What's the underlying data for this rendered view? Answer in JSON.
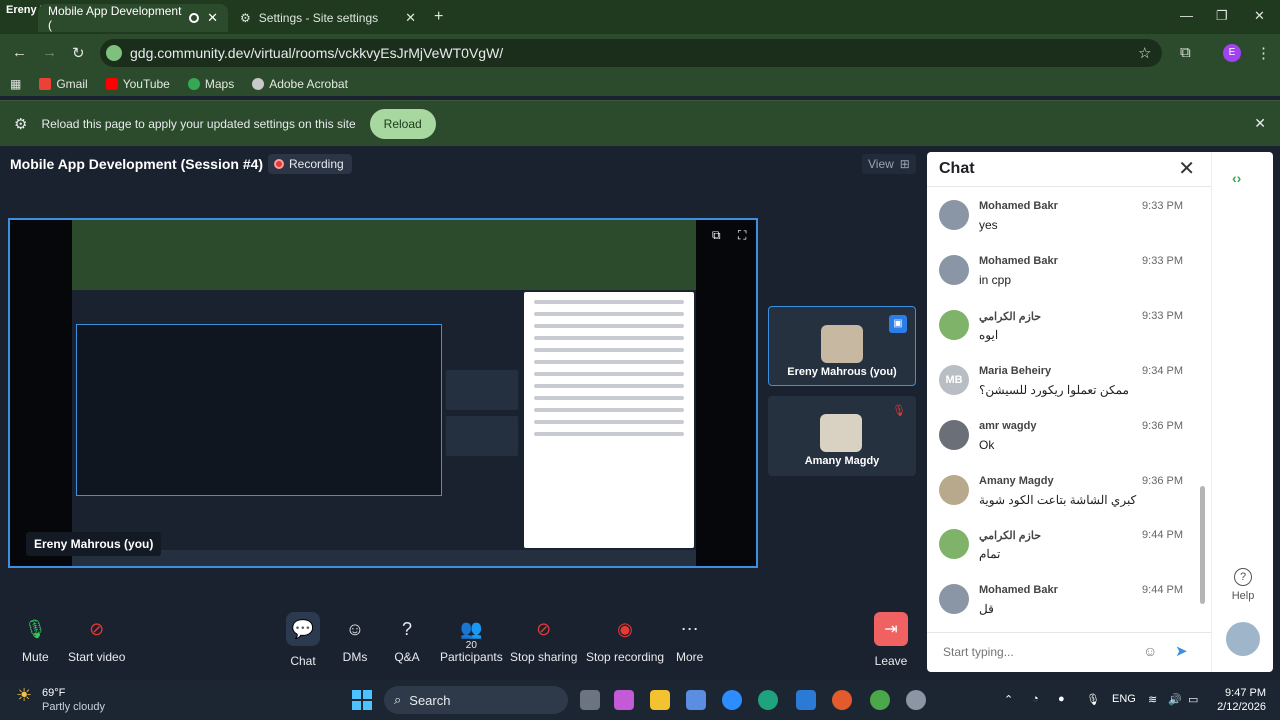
{
  "browser": {
    "profile_name": "Ereny Mahrous",
    "tabs": [
      {
        "label": "Mobile App Development (",
        "active": true
      },
      {
        "label": "Settings - Site settings",
        "active": false
      }
    ],
    "url": "gdg.community.dev/virtual/rooms/vckkvyEsJrMjVeWT0VgW/",
    "bookmarks": [
      "Gmail",
      "YouTube",
      "Maps",
      "Adobe Acrobat"
    ],
    "infobar": {
      "message": "Reload this page to apply your updated settings on this site",
      "button_label": "Reload"
    },
    "profile_avatar": "E"
  },
  "meeting": {
    "title": "Mobile App Development (Session #4)",
    "recording_label": "Recording",
    "view_label": "View",
    "share_owner": "Ereny Mahrous (you)",
    "participants": [
      {
        "name": "Ereny Mahrous (you)",
        "active": true
      },
      {
        "name": "Amany Magdy",
        "active": false
      }
    ],
    "controls": {
      "mute": "Mute",
      "start_video": "Start video",
      "chat": "Chat",
      "dms": "DMs",
      "qa": "Q&A",
      "participants": "Participants",
      "participant_count": "20",
      "stop_sharing": "Stop sharing",
      "stop_recording": "Stop recording",
      "more": "More",
      "leave": "Leave"
    }
  },
  "chat": {
    "title": "Chat",
    "messages": [
      {
        "name": "Mohamed Bakr",
        "time": "9:33 PM",
        "text": "yes",
        "initials": ""
      },
      {
        "name": "Mohamed Bakr",
        "time": "9:33 PM",
        "text": "in cpp",
        "initials": ""
      },
      {
        "name": "حازم الكرامي",
        "time": "9:33 PM",
        "text": "ايوه",
        "initials": ""
      },
      {
        "name": "Maria Beheiry",
        "time": "9:34 PM",
        "text": "ممكن تعملوا ريكورد للسيشن؟",
        "initials": "MB"
      },
      {
        "name": "amr wagdy",
        "time": "9:36 PM",
        "text": "Ok",
        "initials": ""
      },
      {
        "name": "Amany Magdy",
        "time": "9:36 PM",
        "text": "كبري الشاشة بتاعت الكود شوية",
        "initials": ""
      },
      {
        "name": "حازم الكرامي",
        "time": "9:44 PM",
        "text": "تمام",
        "initials": ""
      },
      {
        "name": "Mohamed Bakr",
        "time": "9:44 PM",
        "text": "قل",
        "initials": ""
      }
    ],
    "input_placeholder": "Start typing...",
    "help_label": "Help"
  },
  "taskbar": {
    "temperature": "69°F",
    "condition": "Partly cloudy",
    "search_label": "Search",
    "language": "ENG",
    "time": "9:47 PM",
    "date": "2/12/2026"
  },
  "colors": {
    "browser_chrome": "#2c4a2c",
    "meeting_bg": "#1a2230",
    "accent_blue": "#3d8fe0",
    "recording_red": "#e53935",
    "leave_red": "#f06262",
    "reload_green": "#a8d8a0"
  }
}
